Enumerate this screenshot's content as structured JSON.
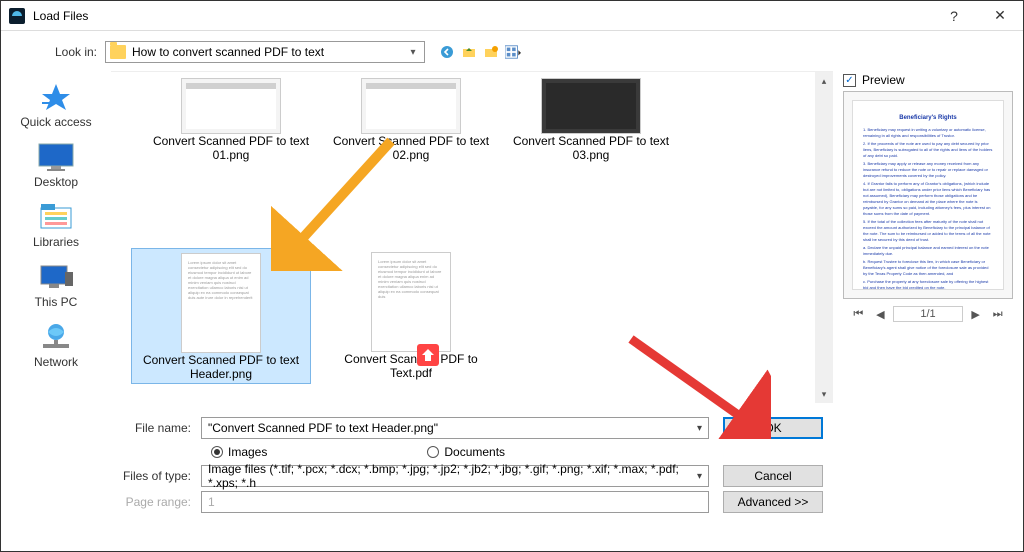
{
  "window": {
    "title": "Load Files",
    "help_icon": "?",
    "close_icon": "✕"
  },
  "toolbar": {
    "look_in_label": "Look in:",
    "look_in_value": "How to convert scanned PDF to text"
  },
  "sidebar": {
    "items": [
      {
        "label": "Quick access",
        "name": "quick-access"
      },
      {
        "label": "Desktop",
        "name": "desktop"
      },
      {
        "label": "Libraries",
        "name": "libraries"
      },
      {
        "label": "This PC",
        "name": "this-pc"
      },
      {
        "label": "Network",
        "name": "network"
      }
    ]
  },
  "files": {
    "row1": [
      {
        "label": "Convert Scanned PDF to text 01.png"
      },
      {
        "label": "Convert Scanned PDF to text 02.png"
      },
      {
        "label": "Convert Scanned PDF to text 03.png"
      }
    ],
    "row2": [
      {
        "label": "Convert Scanned PDF to text Header.png",
        "selected": true
      },
      {
        "label": "Convert Scanned PDF to Text.pdf"
      }
    ]
  },
  "form": {
    "file_name_label": "File name:",
    "file_name_value": "\"Convert Scanned PDF to text Header.png\"",
    "radio_images": "Images",
    "radio_documents": "Documents",
    "files_of_type_label": "Files of type:",
    "files_of_type_value": "Image files (*.tif; *.pcx; *.dcx; *.bmp; *.jpg; *.jp2; *.jb2; *.jbg; *.gif; *.png; *.xif; *.max; *.pdf; *.xps; *.h",
    "page_range_label": "Page range:",
    "page_range_value": "1",
    "ok_label": "OK",
    "cancel_label": "Cancel",
    "advanced_label": "Advanced >>"
  },
  "preview": {
    "checkbox_label": "Preview",
    "page_indicator": "1/1",
    "doc_title": "Beneficiary's Rights"
  }
}
